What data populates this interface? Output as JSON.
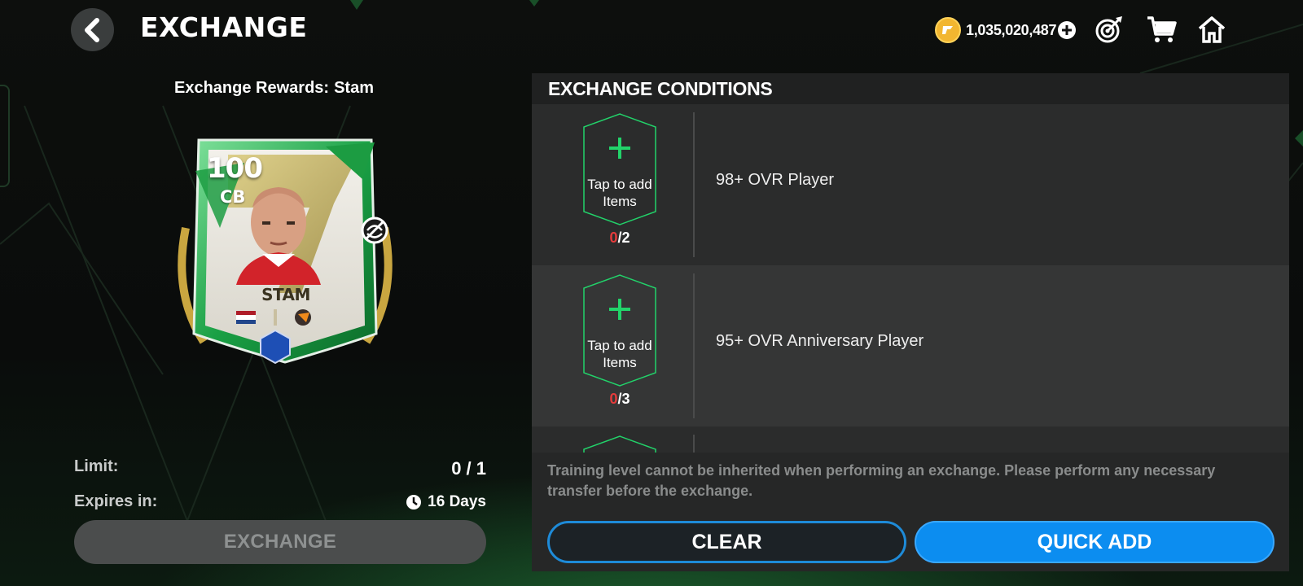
{
  "header": {
    "title": "EXCHANGE",
    "coins": "1,035,020,487",
    "icons": [
      "back-icon",
      "fc-points-coin-icon",
      "add-coin-icon",
      "objectives-target-icon",
      "store-cart-icon",
      "home-icon"
    ]
  },
  "reward": {
    "label": "Exchange Rewards:",
    "player": "Stam",
    "card": {
      "ovr": "100",
      "position": "CB",
      "name": "STAM",
      "nation_flag": "netherlands-flag",
      "club_badge": "club-badge"
    }
  },
  "info": {
    "limit_label": "Limit:",
    "limit_value": "0 / 1",
    "expires_label": "Expires in:",
    "expires_value": "16 Days"
  },
  "exchange_button": "EXCHANGE",
  "conditions": {
    "title": "EXCHANGE CONDITIONS",
    "items": [
      {
        "slot_label": "Tap to add Items",
        "current": "0",
        "required": "/2",
        "requirement": "98+ OVR Player"
      },
      {
        "slot_label": "Tap to add Items",
        "current": "0",
        "required": "/3",
        "requirement": "95+ OVR Anniversary Player"
      }
    ],
    "note": "Training level cannot be inherited when performing an exchange. Please perform any necessary transfer before the exchange.",
    "clear_button": "CLEAR",
    "quick_add_button": "QUICK ADD"
  },
  "colors": {
    "accent_blue": "#0c8df0",
    "slot_green": "#22d36a",
    "count_red": "#e53b3b",
    "coin_gold": "#f2b630"
  }
}
